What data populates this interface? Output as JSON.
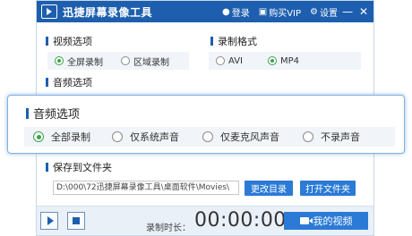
{
  "app": {
    "title": "迅捷屏幕录像工具",
    "login_label": "登录",
    "buy_vip_label": "购买VIP",
    "settings_label": "设置",
    "minimize_glyph": "—",
    "close_glyph": "✕"
  },
  "video_options": {
    "title": "视频选项",
    "options": [
      "全屏录制",
      "区域录制"
    ],
    "selected": "全屏录制"
  },
  "record_format": {
    "title": "录制格式",
    "options": [
      "AVI",
      "MP4"
    ],
    "selected": "MP4"
  },
  "audio_options": {
    "title": "音频选项"
  },
  "audio_popup": {
    "title": "音频选项",
    "options": [
      "全部录制",
      "仅系统声音",
      "仅麦克风声音",
      "不录声音"
    ],
    "selected": "全部录制"
  },
  "save_folder": {
    "title": "保存到文件夹",
    "path": "D:\\000\\72迅捷屏幕录像工具\\桌面软件\\Movies\\",
    "change_button": "更改目录",
    "open_button": "打开文件夹"
  },
  "bottom": {
    "duration_label": "录制时长：",
    "timer": "00:00:00",
    "my_videos_button": "我的视频"
  },
  "icons": {
    "logo": "screen-recorder-icon",
    "user": "user-icon",
    "cart": "cart-icon",
    "gear": "gear-icon",
    "play": "play-icon",
    "stop": "stop-icon",
    "camera": "camera-icon"
  },
  "colors": {
    "brand": "#1d5fae",
    "accent_button": "#2b7ad6",
    "radio_selected": "#3aa348",
    "popup_border": "#7fb1e3"
  }
}
